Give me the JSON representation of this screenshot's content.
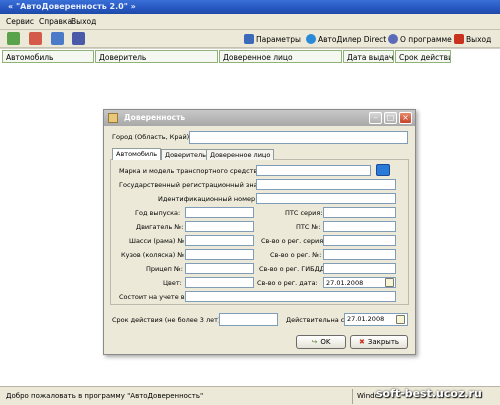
{
  "window": {
    "title": "« \"АвтоДоверенность 2.0\" »"
  },
  "menu": [
    "Сервис",
    "Справка",
    "Выход"
  ],
  "toolbar": {
    "icons": [
      "add-icon",
      "delete-icon",
      "edit-icon",
      "print-icon"
    ],
    "params_label": "Параметры",
    "dealer_label": "АвтоДилер Direct",
    "about_label": "О программе",
    "exit_label": "Выход"
  },
  "columns": [
    "Автомобиль",
    "Доверитель",
    "Доверенное лицо",
    "Дата выдачи",
    "Срок действия"
  ],
  "status": {
    "message": "Добро пожаловать в программу \"АвтоДоверенность\"",
    "right": "Windo"
  },
  "watermark": "soft-best.ucoz.ru",
  "dialog": {
    "title": "Доверенность",
    "city_label": "Город (Область, Край) :",
    "city_value": "",
    "tabs": [
      "Автомобиль",
      "Доверитель",
      "Доверенное лицо"
    ],
    "make_label": "Марка и модель транспортного средства:",
    "reg_plate_label": "Государственный регистрационный знак:",
    "vin_label": "Идентификационный номер (VIN):",
    "year_label": "Год выпуска:",
    "engine_label": "Двигатель №:",
    "chassis_label": "Шасси (рама) №:",
    "body_label": "Кузов (коляска) №:",
    "trailer_label": "Прицеп №:",
    "color_label": "Цвет:",
    "registered_label": "Состоит на учете в:",
    "pts_series_label": "ПТС серия:",
    "pts_no_label": "ПТС №:",
    "reg_series_label": "Св-во о рег. серия:",
    "reg_no_label": "Св-во о рег. №:",
    "reg_gibdd_label": "Св-во о рег. ГИБДД:",
    "reg_date_label": "Св-во о рег. дата:",
    "reg_date_value": "27.01.2008",
    "validity_label": "Срок действия (не более 3 лет):",
    "valid_from_label": "Действительна с:",
    "valid_from_value": "27.01.2008",
    "ok_label": "OK",
    "close_label": "Закрыть"
  }
}
